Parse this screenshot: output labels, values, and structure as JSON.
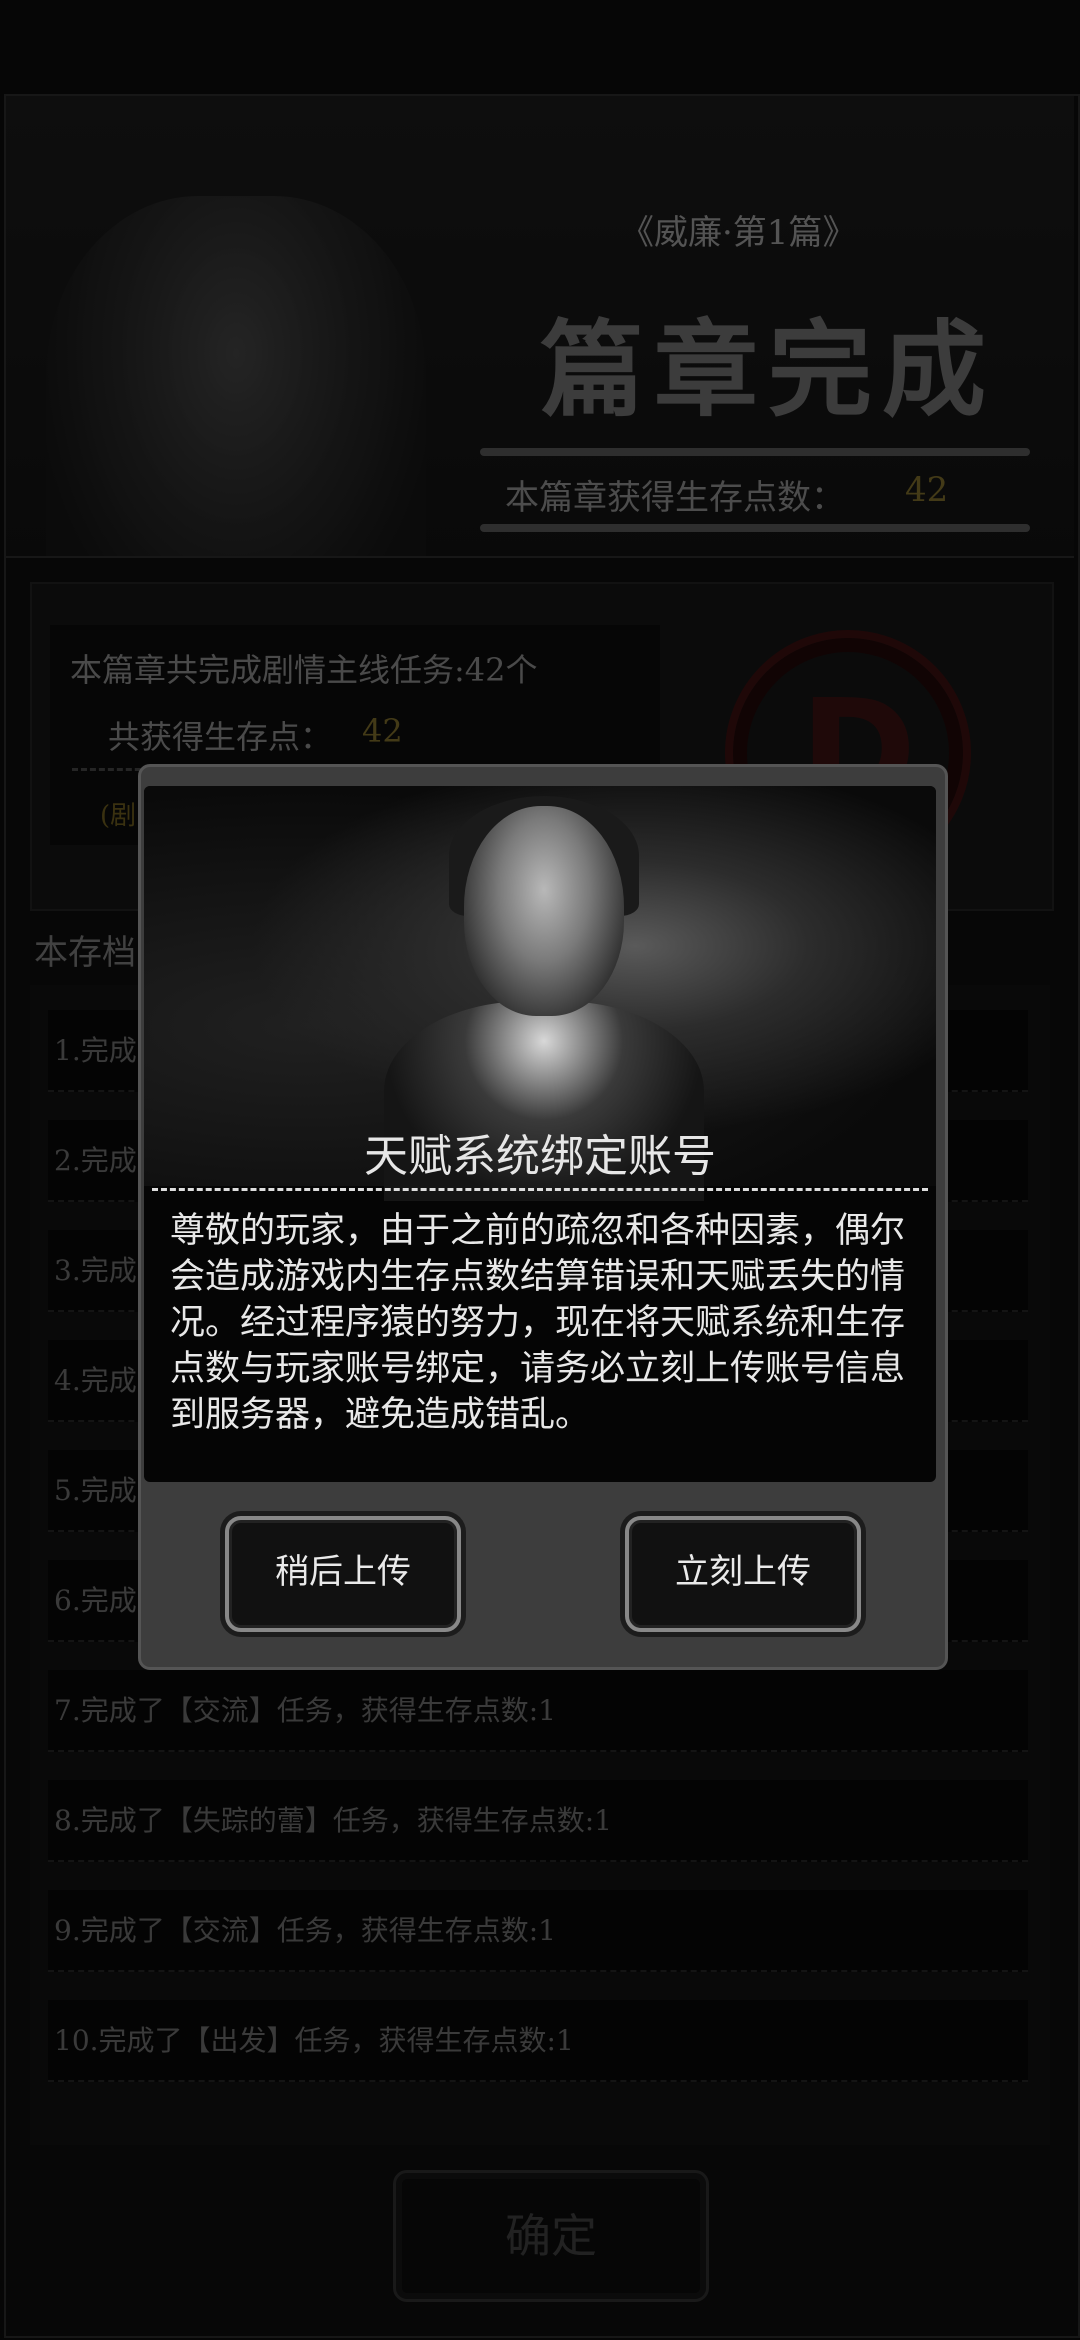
{
  "banner": {
    "chapter_subtitle": "《威廉·第1篇》",
    "chapter_title": "篇章完成",
    "points_label": "本篇章获得生存点数：",
    "points_value": "42"
  },
  "summary": {
    "line1": "本篇章共完成剧情主线任务:42个",
    "line2_label": "共获得生存点：",
    "line2_value": "42",
    "note": "(剧",
    "stamp_letter": "D"
  },
  "archive_label": "本存档",
  "tasks": [
    "1.完成",
    "2.完成",
    "3.完成",
    "4.完成",
    "5.完成",
    "6.完成",
    "7.完成了【交流】任务，获得生存点数:1",
    "8.完成了【失踪的蕾】任务，获得生存点数:1",
    "9.完成了【交流】任务，获得生存点数:1",
    "10.完成了【出发】任务，获得生存点数:1"
  ],
  "confirm_label": "确定",
  "modal": {
    "title": "天赋系统绑定账号",
    "body": "尊敬的玩家，由于之前的疏忽和各种因素，偶尔会造成游戏内生存点数结算错误和天赋丢失的情况。经过程序猿的努力，现在将天赋系统和生存点数与玩家账号绑定，请务必立刻上传账号信息到服务器，避免造成错乱。",
    "later_label": "稍后上传",
    "now_label": "立刻上传"
  }
}
